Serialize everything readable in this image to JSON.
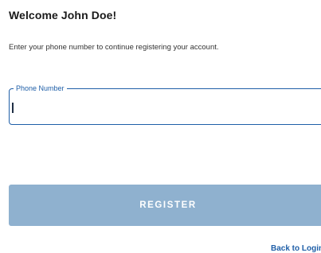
{
  "header": {
    "title": "Welcome John Doe!",
    "subtitle": "Enter your phone number to continue registering your account."
  },
  "phone_field": {
    "label": "Phone Number",
    "value": "",
    "placeholder": ""
  },
  "actions": {
    "register_label": "REGISTER",
    "back_to_login_label": "Back to Login"
  },
  "colors": {
    "accent": "#1f5fa8",
    "button_disabled": "#8fb1cf",
    "button_text": "#ffffff"
  }
}
